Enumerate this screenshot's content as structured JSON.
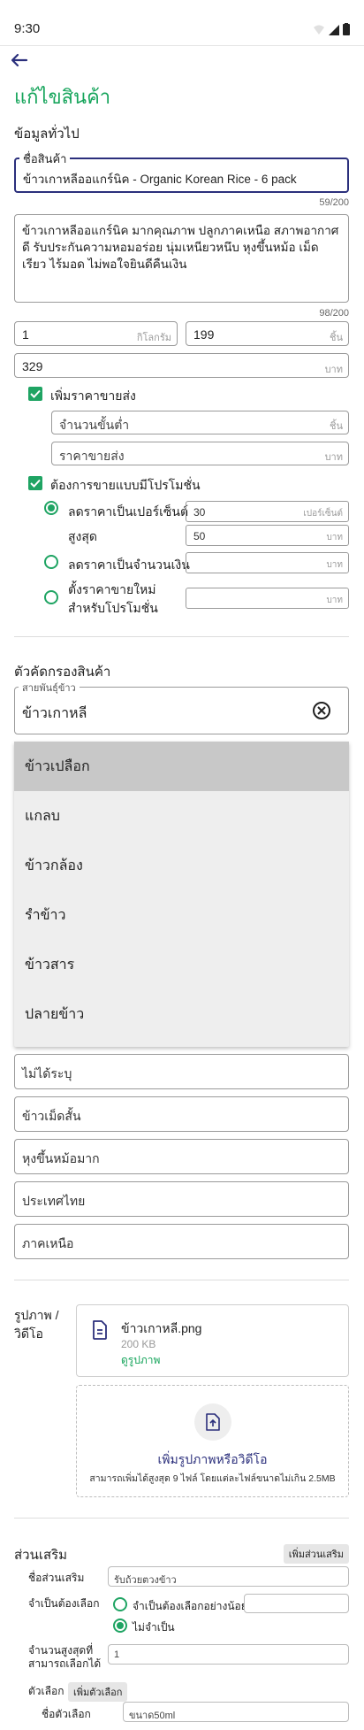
{
  "status_bar": {
    "time": "9:30"
  },
  "page": {
    "title": "แก้ไขสินค้า"
  },
  "general": {
    "section_title": "ข้อมูลทั่วไป",
    "name_label": "ชื่อสินค้า",
    "name_value": "ข้าวเกาหลีออแกร์นิค - Organic Korean Rice - 6 pack",
    "name_counter": "59/200",
    "description": "ข้าวเกาหลีออแกร์นิค มากคุณภาพ ปลูกภาคเหนือ สภาพอากาศดี รับประกันความหอมอร่อย นุ่มเหนียวหนึบ หุงขึ้นหม้อ เม็ดเรียว ไร้มอด ไม่พอใจยินดีคืนเงิน",
    "description_counter": "98/200",
    "weight_value": "1",
    "weight_unit": "กิโลกรัม",
    "stock_value": "199",
    "stock_unit": "ชิ้น",
    "price_value": "329",
    "price_unit": "บาท"
  },
  "wholesale": {
    "checkbox_label": "เพิ่มราคาขายส่ง",
    "min_qty_placeholder": "จำนวนขั้นต่ำ",
    "min_qty_unit": "ชิ้น",
    "price_placeholder": "ราคาขายส่ง",
    "price_unit": "บาท"
  },
  "promotion": {
    "checkbox_label": "ต้องการขายแบบมีโปรโมชั่น",
    "percent_label": "ลดราคาเป็นเปอร์เซ็นต์",
    "percent_value": "30",
    "percent_unit": "เปอร์เซ็นต์",
    "max_label": "สูงสุด",
    "max_value": "50",
    "max_unit": "บาท",
    "amount_label": "ลดราคาเป็นจำนวนเงิน",
    "amount_unit": "บาท",
    "newprice_label_1": "ตั้งราคาขายใหม่",
    "newprice_label_2": "สำหรับโปรโมชั่น",
    "newprice_unit": "บาท"
  },
  "filters": {
    "section_title": "ตัวคัดกรองสินค้า",
    "variety_label": "สายพันธ์ุข้าว",
    "variety_value": "ข้าวเกาหลี",
    "dropdown_options": [
      "ข้าวเปลือก",
      "แกลบ",
      "ข้าวกล้อง",
      "รำข้าว",
      "ข้าวสาร",
      "ปลายข้าว"
    ],
    "fields": [
      "ไม่ได้ระบุ",
      "ข้าวเม็ดสั้น",
      "หุงขึ้นหม้อมาก",
      "ประเทศไทย",
      "ภาคเหนือ"
    ]
  },
  "media": {
    "label_1": "รูปภาพ /",
    "label_2": "วิดีโอ",
    "file_name": "ข้าวเกาหลี.png",
    "file_size": "200 KB",
    "view_link": "ดูรูปภาพ",
    "upload_title": "เพิ่มรูปภาพหรือวิดีโอ",
    "upload_hint": "สามารถเพิ่มได้สูงสุด 9 ไฟล์ โดยแต่ละไฟล์ขนาดไม่เกิน 2.5MB"
  },
  "addons": {
    "section_title": "ส่วนเสริม",
    "add_button": "เพิ่มส่วนเสริม",
    "name_label": "ชื่อส่วนเสริม",
    "name_value": "รับถ้วยตวงข้าว",
    "required_label": "จำเป็นต้องเลือก",
    "opt_min_label": "จำเป็นต้องเลือกอย่างน้อย",
    "opt_not_required": "ไม่จำเป็น",
    "max_label_1": "จำนวนสูงสุดที่",
    "max_label_2": "สามารถเลือกได้",
    "max_value": "1",
    "choices_label": "ตัวเลือก",
    "add_choice_button": "เพิ่มตัวเลือก",
    "choice_name_label": "ชื่อตัวเลือก",
    "choice_name_value": "ขนาด50ml"
  },
  "colors": {
    "accent": "#17a55c",
    "focus": "#2b2f7c",
    "dropdown_bg": "#eeeeee",
    "dropdown_selected": "#c8c8c8"
  },
  "icons": {
    "back": "arrow-left-icon",
    "clear": "circle-x-icon",
    "file": "file-icon",
    "upload": "upload-icon"
  }
}
